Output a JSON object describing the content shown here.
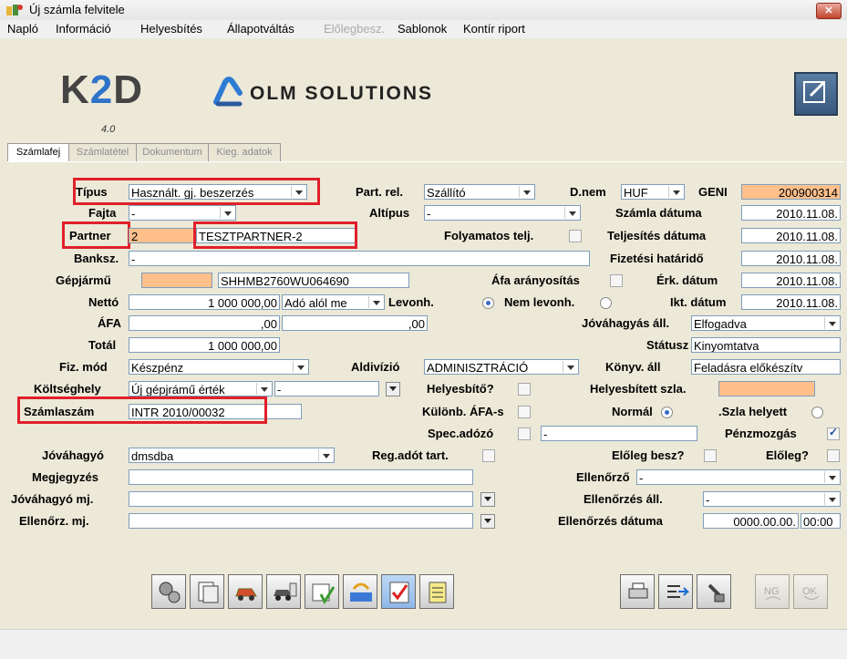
{
  "window": {
    "title": "Új számla felvitele"
  },
  "menu": [
    "Napló",
    "Információ",
    "Helyesbítés",
    "Állapotváltás",
    "Előlegbesz.",
    "Sablonok",
    "Kontír riport"
  ],
  "branding": {
    "k2d_left": "K",
    "k2d_mid": "2",
    "k2d_right": "D",
    "k2d_version": "4.0",
    "company": "OLM SOLUTIONS"
  },
  "tabs": [
    "Számlafej",
    "Számlatétel",
    "Dokumentum",
    "Kieg. adatok"
  ],
  "form": {
    "tipus_label": "Típus",
    "tipus_value": "Használt. gj. beszerzés",
    "partrel_label": "Part. rel.",
    "partrel_value": "Szállító",
    "dnem_label": "D.nem",
    "dnem_value": "HUF",
    "geni_label": "GENI",
    "geni_value": "200900314",
    "fajta_label": "Fajta",
    "fajta_value": "-",
    "altipus_label": "Altípus",
    "altipus_value": "-",
    "szamla_datuma_label": "Számla dátuma",
    "szamla_datuma_value": "2010.11.08.",
    "partner_label": "Partner",
    "partner_code": "2",
    "partner_name": "TESZTPARTNER-2",
    "folyamatos_label": "Folyamatos telj.",
    "teljesites_label": "Teljesítés dátuma",
    "teljesites_value": "2010.11.08.",
    "banksz_label": "Banksz.",
    "banksz_value": "-",
    "fizetesi_label": "Fizetési határidő",
    "fizetesi_value": "2010.11.08.",
    "gepjarmu_label": "Gépjármű",
    "gepjarmu_value": "SHHMB2760WU064690",
    "afa_arany_label": "Áfa arányosítás",
    "erk_label": "Érk. dátum",
    "erk_value": "2010.11.08.",
    "netto_label": "Nettó",
    "netto_value": "1 000 000,00",
    "ado_value": "Adó alól me",
    "levonh_label": "Levonh.",
    "nem_levonh_label": "Nem levonh.",
    "ikt_label": "Ikt. dátum",
    "ikt_value": "2010.11.08.",
    "afa_label": "ÁFA",
    "afa_value1": ",00",
    "afa_value2": ",00",
    "jovahagyas_all_label": "Jóváhagyás áll.",
    "jovahagyas_all_value": "Elfogadva",
    "total_label": "Totál",
    "total_value": "1 000 000,00",
    "statusz_label": "Státusz",
    "statusz_value": "Kinyomtatva",
    "fizmod_label": "Fiz. mód",
    "fizmod_value": "Készpénz",
    "aldivizio_label": "Aldivízió",
    "aldivizio_value": "ADMINISZTRÁCIÓ",
    "konyv_label": "Könyv. áll",
    "konyv_value": "Feladásra előkészítv",
    "koltseg_label": "Költséghely",
    "koltseg_value": "Új gépjrámű érték",
    "koltseg_value2": "-",
    "helyesbito_label": "Helyesbítő?",
    "helyesbitett_label": "Helyesbített szla.",
    "szamlaszam_label": "Számlaszám",
    "szamlaszam_value": "INTR 2010/00032",
    "kulonb_label": "Különb. ÁFA-s",
    "normal_label": "Normál",
    "szla_helyett_label": ".Szla helyett",
    "spec_label": "Spec.adózó",
    "spec_value": "-",
    "penz_label": "Pénzmozgás",
    "jovahagyo_label": "Jóváhagyó",
    "jovahagyo_value": "dmsdba",
    "regado_label": "Reg.adót tart.",
    "eloleg_besz_label": "Előleg besz?",
    "eloleg_label": "Előleg?",
    "megjegyzes_label": "Megjegyzés",
    "megjegyzes_value": "",
    "ellenorzo_label": "Ellenőrző",
    "ellenorzo_value": "-",
    "jov_mj_label": "Jóváhagyó mj.",
    "jov_mj_value": "",
    "ell_all_label": "Ellenőrzés áll.",
    "ell_all_value": "-",
    "ell_mj_label": "Ellenőrz. mj.",
    "ell_mj_value": "",
    "ell_datum_label": "Ellenőrzés dátuma",
    "ell_datum_value": "0000.00.00.",
    "ell_time_value": "00:00"
  },
  "colors": {
    "highlight": "#ffc08c",
    "redbox": "#e0202b"
  }
}
